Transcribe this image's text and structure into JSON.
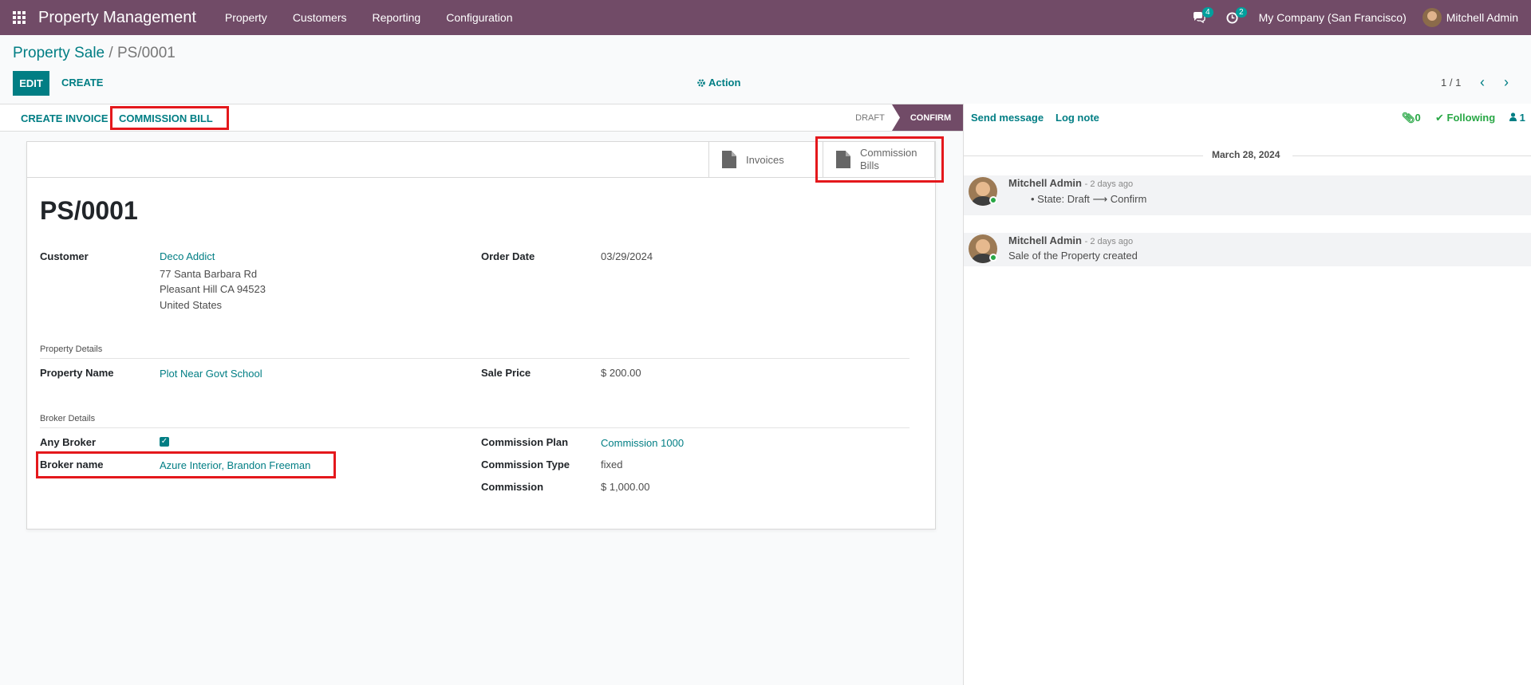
{
  "navbar": {
    "brand": "Property Management",
    "menu": [
      "Property",
      "Customers",
      "Reporting",
      "Configuration"
    ],
    "messages_count": "4",
    "activities_count": "2",
    "company": "My Company (San Francisco)",
    "user": "Mitchell Admin"
  },
  "breadcrumb": {
    "parent": "Property Sale",
    "separator": "/",
    "current": "PS/0001"
  },
  "control": {
    "edit_label": "EDIT",
    "create_label": "CREATE",
    "action_label": "Action",
    "pager": "1 / 1"
  },
  "statusbar": {
    "create_invoice": "CREATE INVOICE",
    "commission_bill": "COMMISSION BILL",
    "stages": [
      "DRAFT",
      "CONFIRM"
    ],
    "active_stage": "CONFIRM"
  },
  "smart_buttons": {
    "invoices": "Invoices",
    "commission_bills_line1": "Commission",
    "commission_bills_line2": "Bills"
  },
  "record": {
    "name": "PS/0001",
    "customer_label": "Customer",
    "customer_name": "Deco Addict",
    "customer_address": [
      "77 Santa Barbara Rd",
      "Pleasant Hill CA 94523",
      "United States"
    ],
    "order_date_label": "Order Date",
    "order_date": "03/29/2024",
    "property_details_title": "Property Details",
    "property_name_label": "Property Name",
    "property_name": "Plot Near Govt School",
    "sale_price_label": "Sale Price",
    "sale_price": "$ 200.00",
    "broker_details_title": "Broker Details",
    "any_broker_label": "Any Broker",
    "any_broker_checked": true,
    "broker_name_label": "Broker name",
    "broker_name": "Azure Interior, Brandon Freeman",
    "commission_plan_label": "Commission Plan",
    "commission_plan": "Commission 1000",
    "commission_type_label": "Commission Type",
    "commission_type": "fixed",
    "commission_label": "Commission",
    "commission": "$ 1,000.00"
  },
  "chatter": {
    "send_message": "Send message",
    "log_note": "Log note",
    "attachments": "0",
    "following": "Following",
    "followers": "1",
    "date": "March 28, 2024",
    "messages": [
      {
        "author": "Mitchell Admin",
        "time": "- 2 days ago",
        "body": "State: Draft ⟶ Confirm"
      },
      {
        "author": "Mitchell Admin",
        "time": "- 2 days ago",
        "body": "Sale of the Property created"
      }
    ]
  }
}
